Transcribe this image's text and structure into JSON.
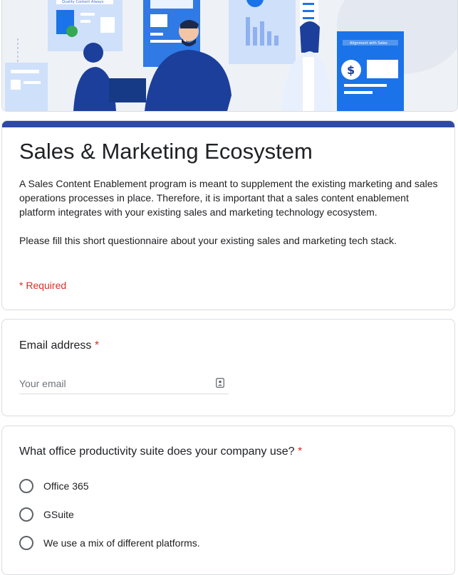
{
  "form": {
    "title": "Sales & Marketing Ecosystem",
    "description_p1": "A Sales Content Enablement program is meant to supplement the existing marketing and sales operations processes in place. Therefore, it is important that a sales content enablement platform integrates with your existing sales and marketing technology ecosystem.",
    "description_p2": "Please fill this short questionnaire about your existing sales and marketing tech stack.",
    "required_note": "* Required",
    "accent_color": "#2e4aa6",
    "required_color": "#d93025"
  },
  "header_image": {
    "banner_left": "Quality Content Always",
    "banner_right": "Alignment with Sales",
    "primary_color": "#1a73e8",
    "dark_color": "#1c3f9b"
  },
  "email": {
    "label": "Email address",
    "required_mark": "*",
    "placeholder": "Your email",
    "icon": "contact-card-icon"
  },
  "suite_question": {
    "label": "What office productivity suite does your company use?",
    "required_mark": "*",
    "options": [
      "Office 365",
      "GSuite",
      "We use a mix of different platforms."
    ]
  }
}
